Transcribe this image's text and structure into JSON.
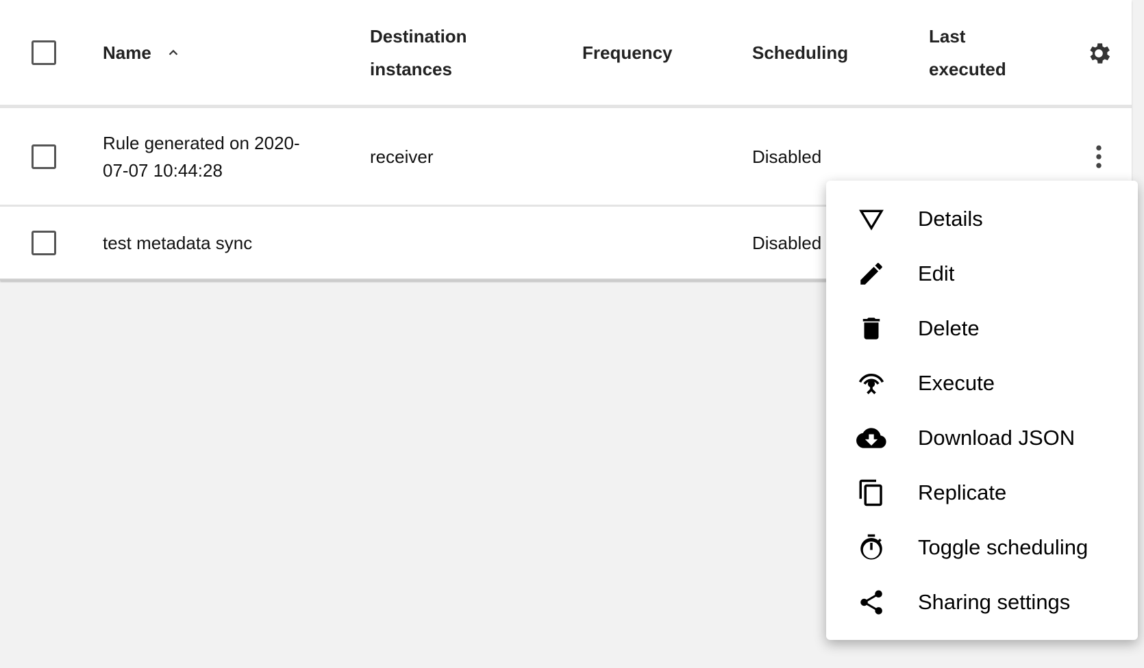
{
  "table": {
    "headers": {
      "name": "Name",
      "destination": "Destination instances",
      "frequency": "Frequency",
      "scheduling": "Scheduling",
      "last_executed": "Last executed"
    },
    "sort": {
      "column": "name",
      "direction": "ascending"
    },
    "rows": [
      {
        "name": "Rule generated on 2020-07-07 10:44:28",
        "destination": "receiver",
        "frequency": "",
        "scheduling": "Disabled",
        "last_executed": ""
      },
      {
        "name": "test metadata sync",
        "destination": "",
        "frequency": "",
        "scheduling": "Disabled",
        "last_executed": ""
      }
    ]
  },
  "context_menu": {
    "items": [
      {
        "label": "Details",
        "icon": "details-triangle-icon"
      },
      {
        "label": "Edit",
        "icon": "pencil-icon"
      },
      {
        "label": "Delete",
        "icon": "trash-icon"
      },
      {
        "label": "Execute",
        "icon": "broadcast-icon"
      },
      {
        "label": "Download JSON",
        "icon": "cloud-download-icon"
      },
      {
        "label": "Replicate",
        "icon": "copy-icon"
      },
      {
        "label": "Toggle scheduling",
        "icon": "timer-icon"
      },
      {
        "label": "Sharing settings",
        "icon": "share-icon"
      }
    ]
  }
}
